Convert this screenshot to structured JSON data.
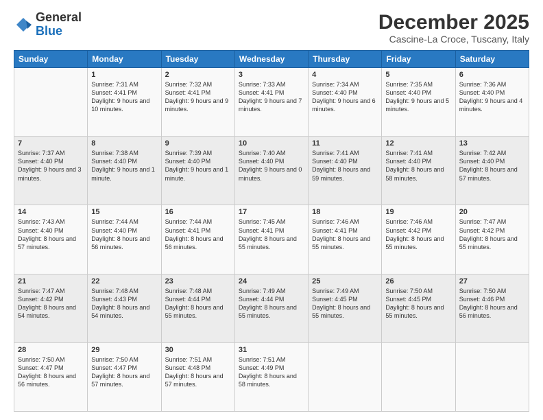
{
  "logo": {
    "general": "General",
    "blue": "Blue"
  },
  "header": {
    "month": "December 2025",
    "location": "Cascine-La Croce, Tuscany, Italy"
  },
  "weekdays": [
    "Sunday",
    "Monday",
    "Tuesday",
    "Wednesday",
    "Thursday",
    "Friday",
    "Saturday"
  ],
  "weeks": [
    [
      {
        "day": "",
        "sunrise": "",
        "sunset": "",
        "daylight": ""
      },
      {
        "day": "1",
        "sunrise": "Sunrise: 7:31 AM",
        "sunset": "Sunset: 4:41 PM",
        "daylight": "Daylight: 9 hours and 10 minutes."
      },
      {
        "day": "2",
        "sunrise": "Sunrise: 7:32 AM",
        "sunset": "Sunset: 4:41 PM",
        "daylight": "Daylight: 9 hours and 9 minutes."
      },
      {
        "day": "3",
        "sunrise": "Sunrise: 7:33 AM",
        "sunset": "Sunset: 4:41 PM",
        "daylight": "Daylight: 9 hours and 7 minutes."
      },
      {
        "day": "4",
        "sunrise": "Sunrise: 7:34 AM",
        "sunset": "Sunset: 4:40 PM",
        "daylight": "Daylight: 9 hours and 6 minutes."
      },
      {
        "day": "5",
        "sunrise": "Sunrise: 7:35 AM",
        "sunset": "Sunset: 4:40 PM",
        "daylight": "Daylight: 9 hours and 5 minutes."
      },
      {
        "day": "6",
        "sunrise": "Sunrise: 7:36 AM",
        "sunset": "Sunset: 4:40 PM",
        "daylight": "Daylight: 9 hours and 4 minutes."
      }
    ],
    [
      {
        "day": "7",
        "sunrise": "Sunrise: 7:37 AM",
        "sunset": "Sunset: 4:40 PM",
        "daylight": "Daylight: 9 hours and 3 minutes."
      },
      {
        "day": "8",
        "sunrise": "Sunrise: 7:38 AM",
        "sunset": "Sunset: 4:40 PM",
        "daylight": "Daylight: 9 hours and 1 minute."
      },
      {
        "day": "9",
        "sunrise": "Sunrise: 7:39 AM",
        "sunset": "Sunset: 4:40 PM",
        "daylight": "Daylight: 9 hours and 1 minute."
      },
      {
        "day": "10",
        "sunrise": "Sunrise: 7:40 AM",
        "sunset": "Sunset: 4:40 PM",
        "daylight": "Daylight: 9 hours and 0 minutes."
      },
      {
        "day": "11",
        "sunrise": "Sunrise: 7:41 AM",
        "sunset": "Sunset: 4:40 PM",
        "daylight": "Daylight: 8 hours and 59 minutes."
      },
      {
        "day": "12",
        "sunrise": "Sunrise: 7:41 AM",
        "sunset": "Sunset: 4:40 PM",
        "daylight": "Daylight: 8 hours and 58 minutes."
      },
      {
        "day": "13",
        "sunrise": "Sunrise: 7:42 AM",
        "sunset": "Sunset: 4:40 PM",
        "daylight": "Daylight: 8 hours and 57 minutes."
      }
    ],
    [
      {
        "day": "14",
        "sunrise": "Sunrise: 7:43 AM",
        "sunset": "Sunset: 4:40 PM",
        "daylight": "Daylight: 8 hours and 57 minutes."
      },
      {
        "day": "15",
        "sunrise": "Sunrise: 7:44 AM",
        "sunset": "Sunset: 4:40 PM",
        "daylight": "Daylight: 8 hours and 56 minutes."
      },
      {
        "day": "16",
        "sunrise": "Sunrise: 7:44 AM",
        "sunset": "Sunset: 4:41 PM",
        "daylight": "Daylight: 8 hours and 56 minutes."
      },
      {
        "day": "17",
        "sunrise": "Sunrise: 7:45 AM",
        "sunset": "Sunset: 4:41 PM",
        "daylight": "Daylight: 8 hours and 55 minutes."
      },
      {
        "day": "18",
        "sunrise": "Sunrise: 7:46 AM",
        "sunset": "Sunset: 4:41 PM",
        "daylight": "Daylight: 8 hours and 55 minutes."
      },
      {
        "day": "19",
        "sunrise": "Sunrise: 7:46 AM",
        "sunset": "Sunset: 4:42 PM",
        "daylight": "Daylight: 8 hours and 55 minutes."
      },
      {
        "day": "20",
        "sunrise": "Sunrise: 7:47 AM",
        "sunset": "Sunset: 4:42 PM",
        "daylight": "Daylight: 8 hours and 55 minutes."
      }
    ],
    [
      {
        "day": "21",
        "sunrise": "Sunrise: 7:47 AM",
        "sunset": "Sunset: 4:42 PM",
        "daylight": "Daylight: 8 hours and 54 minutes."
      },
      {
        "day": "22",
        "sunrise": "Sunrise: 7:48 AM",
        "sunset": "Sunset: 4:43 PM",
        "daylight": "Daylight: 8 hours and 54 minutes."
      },
      {
        "day": "23",
        "sunrise": "Sunrise: 7:48 AM",
        "sunset": "Sunset: 4:44 PM",
        "daylight": "Daylight: 8 hours and 55 minutes."
      },
      {
        "day": "24",
        "sunrise": "Sunrise: 7:49 AM",
        "sunset": "Sunset: 4:44 PM",
        "daylight": "Daylight: 8 hours and 55 minutes."
      },
      {
        "day": "25",
        "sunrise": "Sunrise: 7:49 AM",
        "sunset": "Sunset: 4:45 PM",
        "daylight": "Daylight: 8 hours and 55 minutes."
      },
      {
        "day": "26",
        "sunrise": "Sunrise: 7:50 AM",
        "sunset": "Sunset: 4:45 PM",
        "daylight": "Daylight: 8 hours and 55 minutes."
      },
      {
        "day": "27",
        "sunrise": "Sunrise: 7:50 AM",
        "sunset": "Sunset: 4:46 PM",
        "daylight": "Daylight: 8 hours and 56 minutes."
      }
    ],
    [
      {
        "day": "28",
        "sunrise": "Sunrise: 7:50 AM",
        "sunset": "Sunset: 4:47 PM",
        "daylight": "Daylight: 8 hours and 56 minutes."
      },
      {
        "day": "29",
        "sunrise": "Sunrise: 7:50 AM",
        "sunset": "Sunset: 4:47 PM",
        "daylight": "Daylight: 8 hours and 57 minutes."
      },
      {
        "day": "30",
        "sunrise": "Sunrise: 7:51 AM",
        "sunset": "Sunset: 4:48 PM",
        "daylight": "Daylight: 8 hours and 57 minutes."
      },
      {
        "day": "31",
        "sunrise": "Sunrise: 7:51 AM",
        "sunset": "Sunset: 4:49 PM",
        "daylight": "Daylight: 8 hours and 58 minutes."
      },
      {
        "day": "",
        "sunrise": "",
        "sunset": "",
        "daylight": ""
      },
      {
        "day": "",
        "sunrise": "",
        "sunset": "",
        "daylight": ""
      },
      {
        "day": "",
        "sunrise": "",
        "sunset": "",
        "daylight": ""
      }
    ]
  ]
}
